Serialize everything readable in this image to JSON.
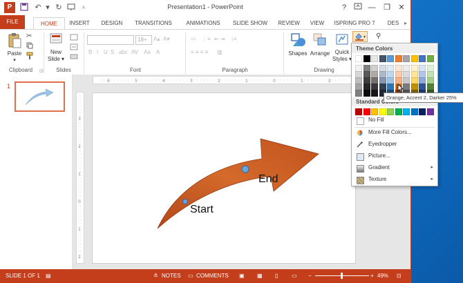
{
  "window": {
    "title": "Presentation1 - PowerPoint"
  },
  "quick_access": {
    "logo_letter": "P",
    "help": "?",
    "minimize": "—",
    "restore": "❐",
    "close": "✕"
  },
  "tabs": [
    "FILE",
    "HOME",
    "INSERT",
    "DESIGN",
    "TRANSITIONS",
    "ANIMATIONS",
    "SLIDE SHOW",
    "REVIEW",
    "VIEW",
    "ISPRING PRO 7",
    "DES"
  ],
  "ribbon": {
    "groups": {
      "clipboard": "Clipboard",
      "slides": "Slides",
      "font": "Font",
      "paragraph": "Paragraph",
      "drawing": "Drawing"
    },
    "buttons": {
      "paste": "Paste",
      "new_slide_1": "New",
      "new_slide_2": "Slide ▾",
      "shapes": "Shapes",
      "arrange": "Arrange",
      "quick_1": "Quick",
      "quick_2": "Styles ▾"
    },
    "font_size": "18+"
  },
  "thumbnail": {
    "number": "1"
  },
  "slide": {
    "label_end": "End",
    "label_start": "Start"
  },
  "status": {
    "slide_of": "SLIDE 1 OF 1",
    "notes": "NOTES",
    "comments": "COMMENTS",
    "zoom": "49%"
  },
  "palette": {
    "theme_colors_label": "Theme Colors",
    "standard_colors_label": "Standard Colors",
    "no_fill": "No Fill",
    "more_fill": "More Fill Colors...",
    "eyedropper": "Eyedropper",
    "picture": "Picture...",
    "gradient": "Gradient",
    "texture": "Texture",
    "theme_top": [
      "#ffffff",
      "#000000",
      "#e7e6e6",
      "#44546a",
      "#5b9bd5",
      "#ed7d31",
      "#a5a5a5",
      "#ffc000",
      "#4472c4",
      "#70ad47"
    ],
    "theme_rows": [
      [
        "#f2f2f2",
        "#808080",
        "#d0cece",
        "#d6dce4",
        "#deebf6",
        "#fbe5d5",
        "#ededed",
        "#fff2cc",
        "#dae3f3",
        "#e2efd9"
      ],
      [
        "#d8d8d8",
        "#595959",
        "#aeaaaa",
        "#adb9ca",
        "#bdd7ee",
        "#f7cbac",
        "#dbdbdb",
        "#fee599",
        "#b4c6e7",
        "#c5e0b3"
      ],
      [
        "#bfbfbf",
        "#3f3f3f",
        "#747070",
        "#8496b0",
        "#9dc3e6",
        "#f4b183",
        "#c9c9c9",
        "#ffd966",
        "#8eaadb",
        "#a8d08d"
      ],
      [
        "#a5a5a5",
        "#262626",
        "#3a3838",
        "#323f4f",
        "#2e75b5",
        "#c55a11",
        "#7b7b7b",
        "#bf8f00",
        "#2f5496",
        "#538135"
      ],
      [
        "#7f7f7f",
        "#0c0c0c",
        "#171616",
        "#222a35",
        "#1e4e79",
        "#833c0b",
        "#525252",
        "#7f6000",
        "#1f3864",
        "#375623"
      ]
    ],
    "standard": [
      "#c00000",
      "#ff0000",
      "#ffc000",
      "#ffff00",
      "#92d050",
      "#00b050",
      "#00b0f0",
      "#0070c0",
      "#002060",
      "#7030a0"
    ]
  },
  "tooltip": "Orange, Accent 2, Darker 25%",
  "colors": {
    "accent": "#c43e1c",
    "arrow": "#c8561e"
  }
}
